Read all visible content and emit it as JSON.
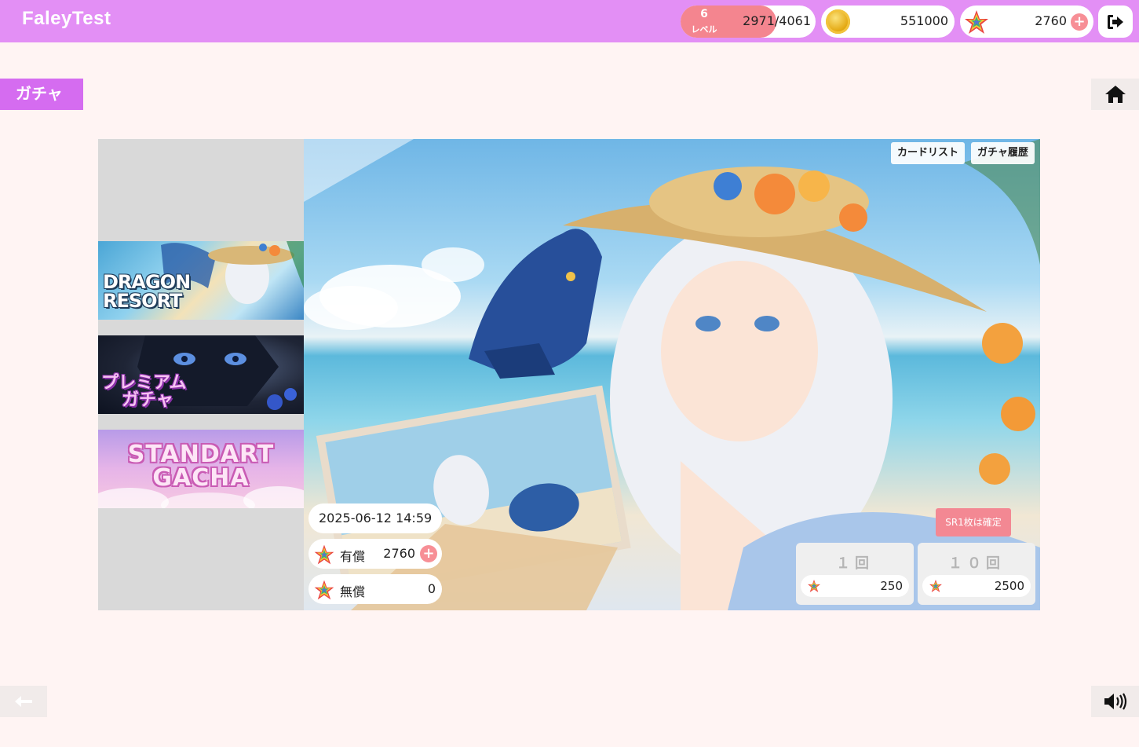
{
  "header": {
    "app_title": "FaleyTest",
    "level": {
      "number": "6",
      "label": "レベル",
      "exp": "2971/4061"
    },
    "coins": {
      "icon": "gold-coin-icon",
      "value": "551000"
    },
    "stars": {
      "icon": "rainbow-star-icon",
      "value": "2760",
      "add_label": "+"
    },
    "logout_icon": "logout-icon"
  },
  "page": {
    "title": "ガチャ",
    "home_icon": "home-icon"
  },
  "banners": [
    {
      "name_lines": [
        "DRAGON",
        "RESORT"
      ]
    },
    {
      "name_lines": [
        "プレミアム",
        "ガチャ"
      ]
    },
    {
      "name_lines": [
        "STANDART",
        "GACHA"
      ]
    }
  ],
  "hero": {
    "card_list_label": "カードリスト",
    "history_label": "ガチャ履歴",
    "end_datetime": "2025-06-12 14:59",
    "paid": {
      "label": "有償",
      "value": "2760",
      "add_label": "+"
    },
    "free": {
      "label": "無償",
      "value": "0"
    },
    "guarantee_label": "SR1枚は確定",
    "pull_single": {
      "label": "１回",
      "cost": "250"
    },
    "pull_ten": {
      "label": "１０回",
      "cost": "2500"
    }
  },
  "footer": {
    "back_icon": "arrow-left-icon",
    "sound_icon": "speaker-icon"
  },
  "colors": {
    "header_bg": "#e38ff5",
    "page_bg": "#fff4f3",
    "title_badge": "#d56cf0",
    "accent_pink": "#f4858f",
    "guarantee_bg": "#f38893"
  }
}
